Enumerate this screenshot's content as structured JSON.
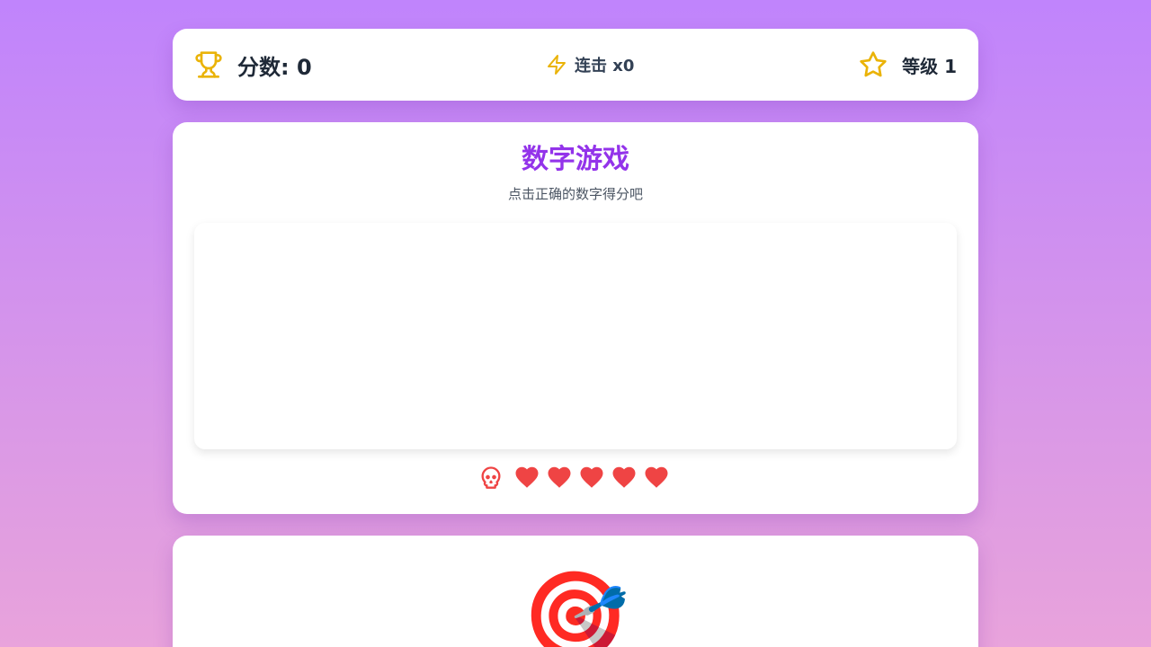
{
  "header": {
    "score_label": "分数: 0",
    "combo_label": "连击 x0",
    "level_label": "等级 1"
  },
  "game": {
    "title": "数字游戏",
    "subtitle": "点击正确的数字得分吧",
    "lives": 5
  },
  "bottom": {
    "glyph": "🎯"
  },
  "icons": {
    "score": "trophy-icon",
    "combo": "lightning-icon",
    "level": "star-icon",
    "lives_marker": "skull-icon",
    "life": "heart-icon"
  },
  "colors": {
    "accent": "#9333ea",
    "icon_gold": "#eab308",
    "heart": "#ef4444"
  }
}
